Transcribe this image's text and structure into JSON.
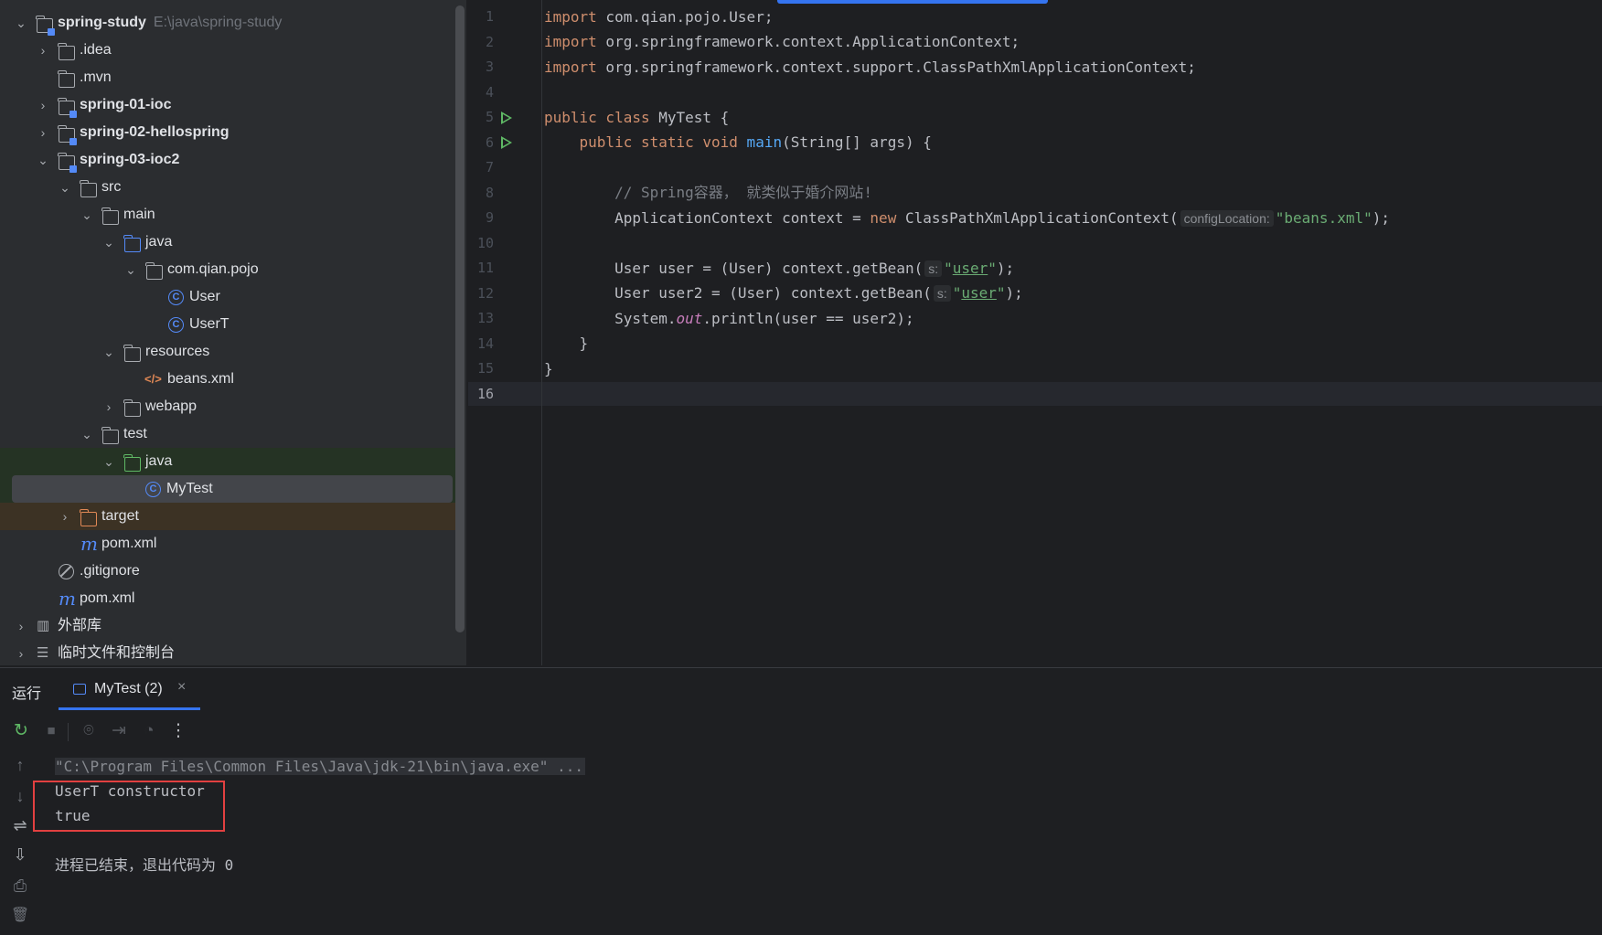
{
  "project_tree": {
    "root": {
      "label": "spring-study",
      "path": "E:\\java\\spring-study"
    },
    "items": [
      {
        "label": ".idea"
      },
      {
        "label": ".mvn"
      },
      {
        "label": "spring-01-ioc"
      },
      {
        "label": "spring-02-hellospring"
      },
      {
        "label": "spring-03-ioc2"
      },
      {
        "label": "src"
      },
      {
        "label": "main"
      },
      {
        "label": "java"
      },
      {
        "label": "com.qian.pojo"
      },
      {
        "label": "User"
      },
      {
        "label": "UserT"
      },
      {
        "label": "resources"
      },
      {
        "label": "beans.xml"
      },
      {
        "label": "webapp"
      },
      {
        "label": "test"
      },
      {
        "label": "java"
      },
      {
        "label": "MyTest"
      },
      {
        "label": "target"
      },
      {
        "label": "pom.xml"
      },
      {
        "label": ".gitignore"
      },
      {
        "label": "pom.xml"
      },
      {
        "label": "外部库"
      },
      {
        "label": "临时文件和控制台"
      }
    ],
    "selected": "MyTest"
  },
  "editor": {
    "line_numbers": [
      "1",
      "2",
      "3",
      "4",
      "5",
      "6",
      "7",
      "8",
      "9",
      "10",
      "11",
      "12",
      "13",
      "14",
      "15",
      "16"
    ],
    "current_line": "16",
    "code": {
      "l1_kw": "import",
      "l1_rest": " com.qian.pojo.User;",
      "l2_kw": "import",
      "l2_rest": " org.springframework.context.ApplicationContext;",
      "l3_kw": "import",
      "l3_rest": " org.springframework.context.support.ClassPathXmlApplicationContext;",
      "l5_kw1": "public",
      "l5_kw2": " class",
      "l5_rest": " MyTest {",
      "l6_indent": "    ",
      "l6_kw": "public static void",
      "l6_fn": " main",
      "l6_rest": "(String[] args) {",
      "l8_indent": "        ",
      "l8_comment": "// Spring容器， 就类似于婚介网站!",
      "l9_pre": "        ApplicationContext context = ",
      "l9_kw": "new",
      "l9_mid": " ClassPathXmlApplicationContext(",
      "l9_hint": "configLocation:",
      "l9_str": "\"beans.xml\"",
      "l9_end": ");",
      "l11_pre": "        User user = (User) context.getBean(",
      "l11_hint": "s:",
      "l11_q1": "\"",
      "l11_str": "user",
      "l11_q2": "\"",
      "l11_end": ");",
      "l12_pre": "        User user2 = (User) context.getBean(",
      "l12_hint": "s:",
      "l12_q1": "\"",
      "l12_str": "user",
      "l12_q2": "\"",
      "l12_end": ");",
      "l13_pre": "        System.",
      "l13_field": "out",
      "l13_end": ".println(user == user2);",
      "l14": "    }",
      "l15": "}"
    }
  },
  "run_panel": {
    "title": "运行",
    "tab_label": "MyTest (2)",
    "tab_close": "×",
    "toolbar": {
      "rerun_icon": "↻",
      "stop_icon": "■",
      "camera_icon": "⌾",
      "exit_icon": "⇥",
      "coverage_icon": "◔",
      "more_icon": "⋮"
    },
    "side_tools": [
      "↑",
      "↓",
      "⇌",
      "⇩",
      "⎙",
      "🗑"
    ],
    "console": {
      "command": "\"C:\\Program Files\\Common Files\\Java\\jdk-21\\bin\\java.exe\" ...",
      "output_1": "UserT constructor",
      "output_2": "true",
      "exit_message": "进程已结束，退出代码为 0"
    }
  },
  "colors": {
    "accent": "#3574f0",
    "run_green": "#5fb865",
    "highlight_red": "#e24040"
  }
}
